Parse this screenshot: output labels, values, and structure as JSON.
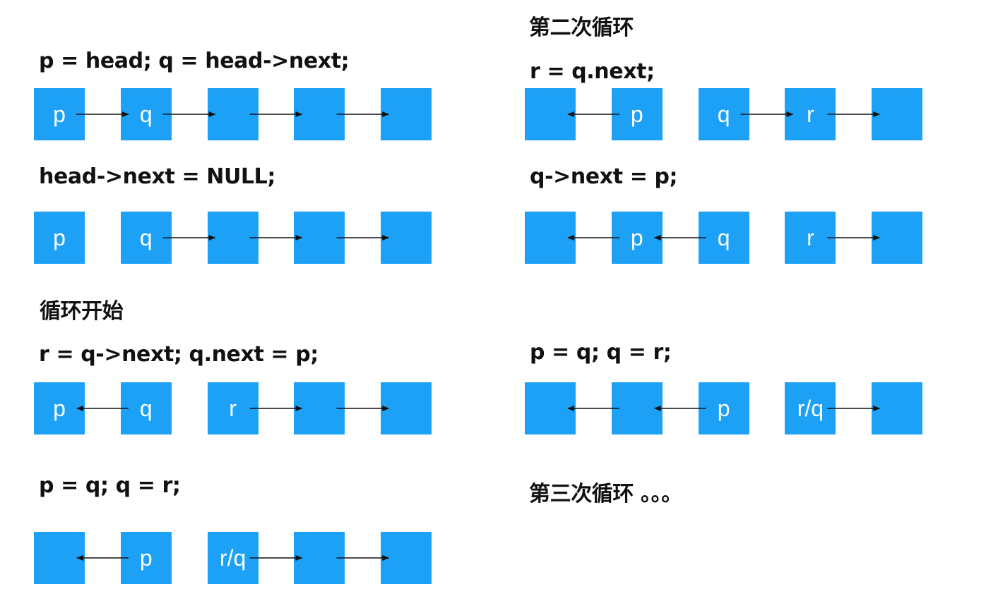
{
  "colors": {
    "node": "#1da1f7",
    "node_text": "#ffffff",
    "arrow": "#111111",
    "text": "#111111"
  },
  "steps": [
    {
      "label": "p = head; q = head->next;",
      "nodes": [
        "p",
        "q",
        "",
        "",
        ""
      ],
      "arrows": [
        [
          0,
          1
        ],
        [
          1,
          2
        ],
        [
          2,
          3
        ],
        [
          3,
          4
        ]
      ]
    },
    {
      "label": "head->next = NULL;",
      "nodes": [
        "p",
        "q",
        "",
        "",
        ""
      ],
      "arrows": [
        [
          1,
          2
        ],
        [
          2,
          3
        ],
        [
          3,
          4
        ]
      ]
    },
    {
      "label": "r = q->next; q.next = p;",
      "heading": "循环开始",
      "nodes": [
        "p",
        "q",
        "r",
        "",
        ""
      ],
      "arrows": [
        [
          1,
          0
        ],
        [
          2,
          3
        ],
        [
          3,
          4
        ]
      ]
    },
    {
      "label": "p = q; q = r;",
      "nodes": [
        "",
        "p",
        "r/q",
        "",
        ""
      ],
      "arrows": [
        [
          1,
          0
        ],
        [
          2,
          3
        ],
        [
          3,
          4
        ]
      ]
    },
    {
      "label": "r = q.next;",
      "heading": "第二次循环",
      "nodes": [
        "",
        "p",
        "q",
        "r",
        ""
      ],
      "arrows": [
        [
          1,
          0
        ],
        [
          2,
          3
        ],
        [
          3,
          4
        ]
      ]
    },
    {
      "label": "q->next = p;",
      "nodes": [
        "",
        "p",
        "q",
        "r",
        ""
      ],
      "arrows": [
        [
          1,
          0
        ],
        [
          2,
          1
        ],
        [
          3,
          4
        ]
      ]
    },
    {
      "label": "p = q; q = r;",
      "nodes": [
        "",
        "",
        "p",
        "r/q",
        ""
      ],
      "arrows": [
        [
          1,
          0
        ],
        [
          2,
          1
        ],
        [
          3,
          4
        ]
      ]
    }
  ],
  "footer": "第三次循环 。。。"
}
